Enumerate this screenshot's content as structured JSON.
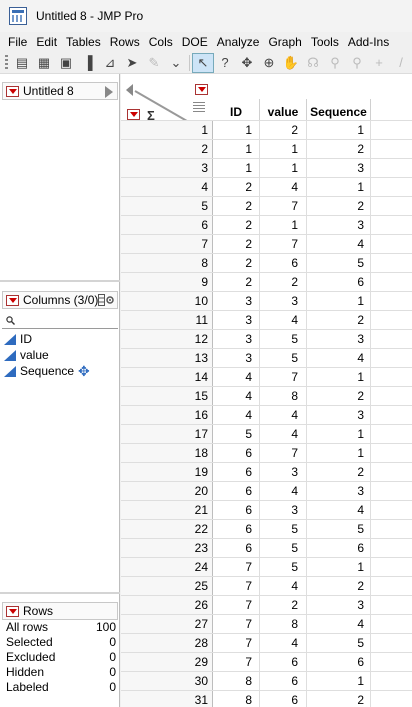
{
  "window": {
    "title": "Untitled 8 - JMP Pro"
  },
  "menu": [
    "File",
    "Edit",
    "Tables",
    "Rows",
    "Cols",
    "DOE",
    "Analyze",
    "Graph",
    "Tools",
    "Add-Ins"
  ],
  "toolbar": [
    {
      "name": "open-table-icon",
      "glyph": "▤",
      "state": "normal"
    },
    {
      "name": "data-grid-icon",
      "glyph": "▦",
      "state": "normal"
    },
    {
      "name": "layout-icon",
      "glyph": "▣",
      "state": "normal"
    },
    {
      "name": "distribution-icon",
      "glyph": "▐",
      "state": "normal"
    },
    {
      "name": "fit-y-by-x-icon",
      "glyph": "⊿",
      "state": "normal"
    },
    {
      "name": "arrow-right-icon",
      "glyph": "➤",
      "state": "normal"
    },
    {
      "name": "pen-icon",
      "glyph": "✎",
      "state": "dim"
    },
    {
      "name": "overflow-chevron-icon",
      "glyph": "⌄",
      "state": "normal"
    },
    {
      "name": "arrow-select-icon",
      "glyph": "↖",
      "state": "selected"
    },
    {
      "name": "help-icon",
      "glyph": "?",
      "state": "normal"
    },
    {
      "name": "brush-icon",
      "glyph": "✥",
      "state": "normal"
    },
    {
      "name": "crosshair-icon",
      "glyph": "⊕",
      "state": "normal"
    },
    {
      "name": "hand-icon",
      "glyph": "✋",
      "state": "dim"
    },
    {
      "name": "lasso-icon",
      "glyph": "☊",
      "state": "dim"
    },
    {
      "name": "magnifier-icon",
      "glyph": "⚲",
      "state": "dim"
    },
    {
      "name": "zoom-icon",
      "glyph": "⚲",
      "state": "dim"
    },
    {
      "name": "plus-icon",
      "glyph": "+",
      "state": "dim"
    },
    {
      "name": "line-icon",
      "glyph": "/",
      "state": "dim"
    }
  ],
  "table_panel": {
    "name": "Untitled 8"
  },
  "columns_panel": {
    "header": "Columns (3/0)",
    "items": [
      "ID",
      "value",
      "Sequence"
    ]
  },
  "rows_panel": {
    "header": "Rows",
    "stats": [
      {
        "label": "All rows",
        "value": "100"
      },
      {
        "label": "Selected",
        "value": "0"
      },
      {
        "label": "Excluded",
        "value": "0"
      },
      {
        "label": "Hidden",
        "value": "0"
      },
      {
        "label": "Labeled",
        "value": "0"
      }
    ]
  },
  "grid": {
    "columns": [
      "ID",
      "value",
      "Sequence"
    ],
    "rows": [
      [
        "1",
        "1",
        "2",
        "1"
      ],
      [
        "2",
        "1",
        "1",
        "2"
      ],
      [
        "3",
        "1",
        "1",
        "3"
      ],
      [
        "4",
        "2",
        "4",
        "1"
      ],
      [
        "5",
        "2",
        "7",
        "2"
      ],
      [
        "6",
        "2",
        "1",
        "3"
      ],
      [
        "7",
        "2",
        "7",
        "4"
      ],
      [
        "8",
        "2",
        "6",
        "5"
      ],
      [
        "9",
        "2",
        "2",
        "6"
      ],
      [
        "10",
        "3",
        "3",
        "1"
      ],
      [
        "11",
        "3",
        "4",
        "2"
      ],
      [
        "12",
        "3",
        "5",
        "3"
      ],
      [
        "13",
        "3",
        "5",
        "4"
      ],
      [
        "14",
        "4",
        "7",
        "1"
      ],
      [
        "15",
        "4",
        "8",
        "2"
      ],
      [
        "16",
        "4",
        "4",
        "3"
      ],
      [
        "17",
        "5",
        "4",
        "1"
      ],
      [
        "18",
        "6",
        "7",
        "1"
      ],
      [
        "19",
        "6",
        "3",
        "2"
      ],
      [
        "20",
        "6",
        "4",
        "3"
      ],
      [
        "21",
        "6",
        "3",
        "4"
      ],
      [
        "22",
        "6",
        "5",
        "5"
      ],
      [
        "23",
        "6",
        "5",
        "6"
      ],
      [
        "24",
        "7",
        "5",
        "1"
      ],
      [
        "25",
        "7",
        "4",
        "2"
      ],
      [
        "26",
        "7",
        "2",
        "3"
      ],
      [
        "27",
        "7",
        "8",
        "4"
      ],
      [
        "28",
        "7",
        "4",
        "5"
      ],
      [
        "29",
        "7",
        "6",
        "6"
      ],
      [
        "30",
        "8",
        "6",
        "1"
      ],
      [
        "31",
        "8",
        "6",
        "2"
      ]
    ]
  }
}
